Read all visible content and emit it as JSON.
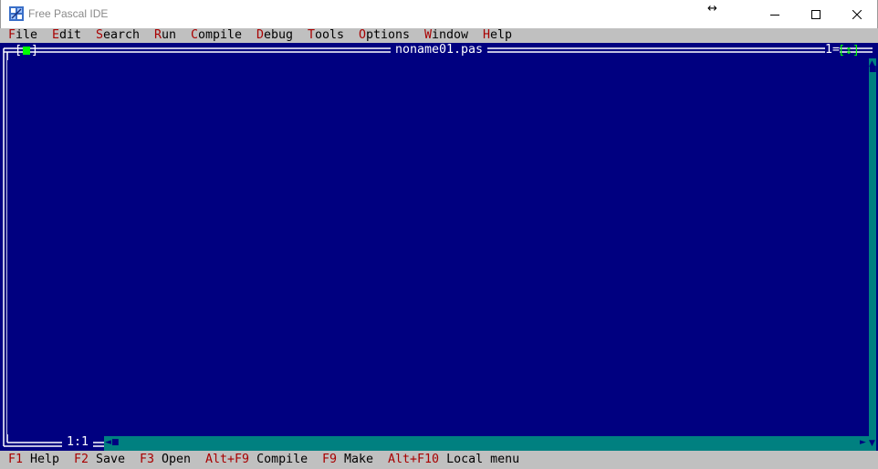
{
  "window": {
    "title": "Free Pascal IDE",
    "resize_cursor_glyph": "↔",
    "icons": [
      "app-icon",
      "minimize-icon",
      "maximize-icon",
      "close-icon"
    ]
  },
  "menubar": {
    "items": [
      {
        "hot": "F",
        "rest": "ile"
      },
      {
        "hot": "E",
        "rest": "dit"
      },
      {
        "hot": "S",
        "rest": "earch"
      },
      {
        "hot": "R",
        "rest": "un"
      },
      {
        "hot": "C",
        "rest": "ompile"
      },
      {
        "hot": "D",
        "rest": "ebug"
      },
      {
        "hot": "T",
        "rest": "ools"
      },
      {
        "hot": "O",
        "rest": "ptions"
      },
      {
        "hot": "W",
        "rest": "indow"
      },
      {
        "hot": "H",
        "rest": "elp"
      }
    ]
  },
  "editor": {
    "filename": "noname01.pas",
    "window_number": "1=",
    "close_box_left": "[",
    "close_box_right": "]",
    "zoom_box": "[↕]",
    "cursor_position": "1:1"
  },
  "statusbar": {
    "items": [
      {
        "key": "F1",
        "label": "Help"
      },
      {
        "key": "F2",
        "label": "Save"
      },
      {
        "key": "F3",
        "label": "Open"
      },
      {
        "key": "Alt+F9",
        "label": "Compile"
      },
      {
        "key": "F9",
        "label": "Make"
      },
      {
        "key": "Alt+F10",
        "label": "Local menu"
      }
    ]
  },
  "colors": {
    "desktop": "#000080",
    "menu_bg": "#c0c0c0",
    "hotkey": "#a80000",
    "frame": "#ffffff",
    "scrollbar": "#008080",
    "close_box": "#00ff00"
  }
}
